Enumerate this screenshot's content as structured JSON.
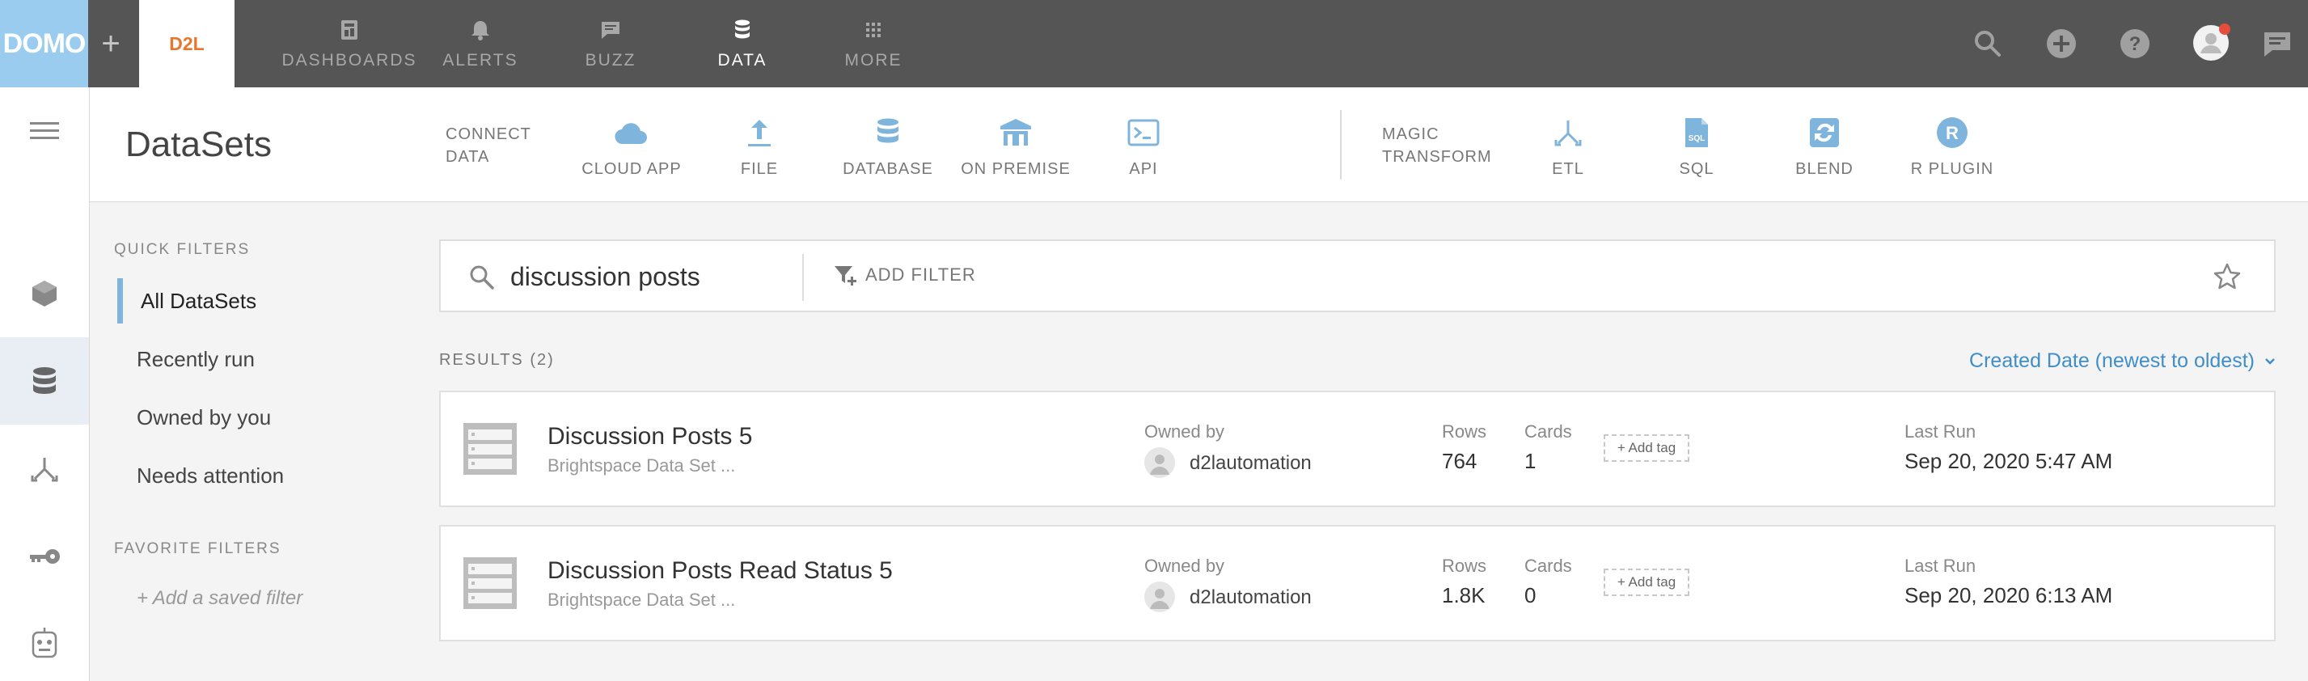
{
  "brand": {
    "logo_text": "DOMO",
    "tab_label": "D2L"
  },
  "topnav": {
    "items": [
      {
        "label": "DASHBOARDS",
        "icon": "dashboards-icon"
      },
      {
        "label": "ALERTS",
        "icon": "bell-icon"
      },
      {
        "label": "BUZZ",
        "icon": "chat-icon"
      },
      {
        "label": "DATA",
        "icon": "database-icon",
        "active": true
      },
      {
        "label": "MORE",
        "icon": "grid-icon"
      }
    ],
    "right_icons": [
      "search-icon",
      "add-circle-icon",
      "help-icon",
      "user-avatar-icon",
      "messages-icon"
    ]
  },
  "header": {
    "title": "DataSets",
    "connect_label": [
      "CONNECT",
      "DATA"
    ],
    "connectors": [
      {
        "label": "CLOUD APP",
        "icon": "cloud-icon"
      },
      {
        "label": "FILE",
        "icon": "upload-icon"
      },
      {
        "label": "DATABASE",
        "icon": "database-icon"
      },
      {
        "label": "ON PREMISE",
        "icon": "building-icon"
      },
      {
        "label": "API",
        "icon": "terminal-icon"
      }
    ],
    "transform_label": [
      "MAGIC",
      "TRANSFORM"
    ],
    "transforms": [
      {
        "label": "ETL",
        "icon": "etl-icon"
      },
      {
        "label": "SQL",
        "icon": "sql-file-icon"
      },
      {
        "label": "BLEND",
        "icon": "blend-icon"
      },
      {
        "label": "R PLUGIN",
        "icon": "r-plugin-icon"
      }
    ]
  },
  "quick_filters": {
    "title": "QUICK FILTERS",
    "items": [
      "All DataSets",
      "Recently run",
      "Owned by you",
      "Needs attention"
    ],
    "active_index": 0
  },
  "favorite_filters": {
    "title": "FAVORITE FILTERS",
    "add_label": "+ Add a saved filter"
  },
  "search": {
    "value": "discussion posts",
    "add_filter_label": "ADD FILTER"
  },
  "results": {
    "label": "RESULTS (2)",
    "sort_label": "Created Date (newest to oldest)",
    "owned_by_label": "Owned by",
    "rows_label": "Rows",
    "cards_label": "Cards",
    "last_run_label": "Last Run",
    "add_tag_label": "+ Add tag",
    "items": [
      {
        "name": "Discussion Posts 5",
        "source": "Brightspace Data Set ...",
        "owner": "d2lautomation",
        "rows": "764",
        "cards": "1",
        "last_run": "Sep 20, 2020 5:47 AM"
      },
      {
        "name": "Discussion Posts Read Status 5",
        "source": "Brightspace Data Set ...",
        "owner": "d2lautomation",
        "rows": "1.8K",
        "cards": "0",
        "last_run": "Sep 20, 2020 6:13 AM"
      }
    ]
  },
  "colors": {
    "topbar": "#555555",
    "logo_bg": "#99ccee",
    "d2l_orange": "#e8772e",
    "accent_blue": "#3f8ec9",
    "icon_blue": "#7fb5dc",
    "notification_red": "#e84c3d"
  }
}
